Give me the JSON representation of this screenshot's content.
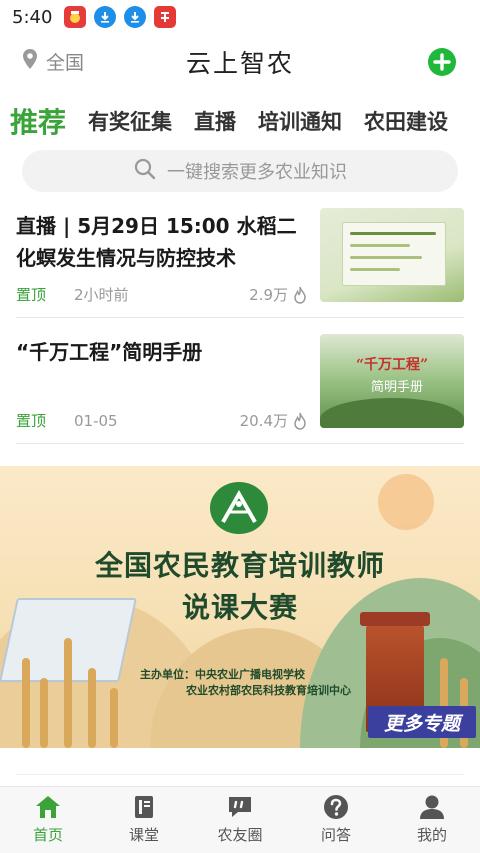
{
  "status_bar": {
    "time": "5:40"
  },
  "header": {
    "location": "全国",
    "title": "云上智农"
  },
  "tabs": [
    {
      "label": "推荐",
      "active": true
    },
    {
      "label": "有奖征集"
    },
    {
      "label": "直播"
    },
    {
      "label": "培训通知"
    },
    {
      "label": "农田建设"
    }
  ],
  "search": {
    "placeholder": "一键搜索更多农业知识"
  },
  "news": [
    {
      "title": "直播 | 5月29日 15:00 水稻二化螟发生情况与防控技术",
      "tag": "置顶",
      "time": "2小时前",
      "views": "2.9万"
    },
    {
      "title": "“千万工程”简明手册",
      "tag": "置顶",
      "time": "01-05",
      "views": "20.4万",
      "thumb_text": "“千万工程”",
      "thumb_sub": "简明手册"
    }
  ],
  "banner": {
    "title_line1": "全国农民教育培训教师",
    "title_line2": "说课大赛",
    "org_line1": "主办单位：中央农业广播电视学校",
    "org_line2": "农业农村部农民科技教育培训中心",
    "more_label": "更多专题"
  },
  "bottom_nav": [
    {
      "label": "首页",
      "icon": "home-icon",
      "active": true
    },
    {
      "label": "课堂",
      "icon": "book-icon"
    },
    {
      "label": "农友圈",
      "icon": "chat-icon"
    },
    {
      "label": "问答",
      "icon": "question-icon"
    },
    {
      "label": "我的",
      "icon": "user-icon"
    }
  ],
  "colors": {
    "accent": "#3aa33a",
    "add_button": "#1fb83a",
    "banner_badge": "#3b3f9e"
  }
}
